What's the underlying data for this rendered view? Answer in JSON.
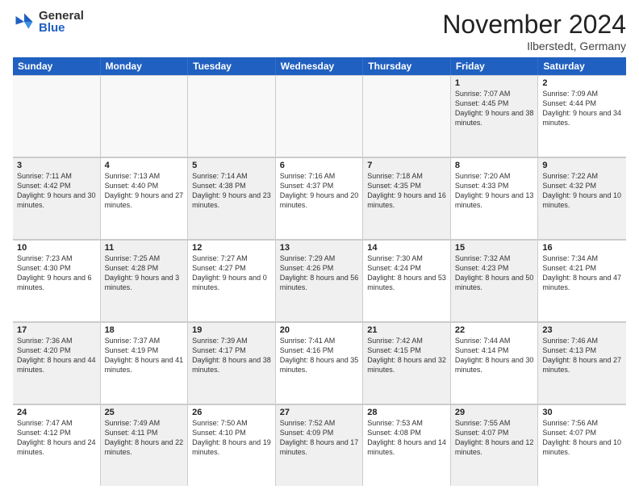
{
  "logo": {
    "general": "General",
    "blue": "Blue"
  },
  "header": {
    "month": "November 2024",
    "location": "Ilberstedt, Germany"
  },
  "weekdays": [
    "Sunday",
    "Monday",
    "Tuesday",
    "Wednesday",
    "Thursday",
    "Friday",
    "Saturday"
  ],
  "weeks": [
    [
      {
        "day": "",
        "info": "",
        "empty": true
      },
      {
        "day": "",
        "info": "",
        "empty": true
      },
      {
        "day": "",
        "info": "",
        "empty": true
      },
      {
        "day": "",
        "info": "",
        "empty": true
      },
      {
        "day": "",
        "info": "",
        "empty": true
      },
      {
        "day": "1",
        "info": "Sunrise: 7:07 AM\nSunset: 4:45 PM\nDaylight: 9 hours\nand 38 minutes.",
        "shaded": true
      },
      {
        "day": "2",
        "info": "Sunrise: 7:09 AM\nSunset: 4:44 PM\nDaylight: 9 hours\nand 34 minutes.",
        "shaded": false
      }
    ],
    [
      {
        "day": "3",
        "info": "Sunrise: 7:11 AM\nSunset: 4:42 PM\nDaylight: 9 hours\nand 30 minutes.",
        "shaded": true
      },
      {
        "day": "4",
        "info": "Sunrise: 7:13 AM\nSunset: 4:40 PM\nDaylight: 9 hours\nand 27 minutes.",
        "shaded": false
      },
      {
        "day": "5",
        "info": "Sunrise: 7:14 AM\nSunset: 4:38 PM\nDaylight: 9 hours\nand 23 minutes.",
        "shaded": true
      },
      {
        "day": "6",
        "info": "Sunrise: 7:16 AM\nSunset: 4:37 PM\nDaylight: 9 hours\nand 20 minutes.",
        "shaded": false
      },
      {
        "day": "7",
        "info": "Sunrise: 7:18 AM\nSunset: 4:35 PM\nDaylight: 9 hours\nand 16 minutes.",
        "shaded": true
      },
      {
        "day": "8",
        "info": "Sunrise: 7:20 AM\nSunset: 4:33 PM\nDaylight: 9 hours\nand 13 minutes.",
        "shaded": false
      },
      {
        "day": "9",
        "info": "Sunrise: 7:22 AM\nSunset: 4:32 PM\nDaylight: 9 hours\nand 10 minutes.",
        "shaded": true
      }
    ],
    [
      {
        "day": "10",
        "info": "Sunrise: 7:23 AM\nSunset: 4:30 PM\nDaylight: 9 hours\nand 6 minutes.",
        "shaded": false
      },
      {
        "day": "11",
        "info": "Sunrise: 7:25 AM\nSunset: 4:28 PM\nDaylight: 9 hours\nand 3 minutes.",
        "shaded": true
      },
      {
        "day": "12",
        "info": "Sunrise: 7:27 AM\nSunset: 4:27 PM\nDaylight: 9 hours\nand 0 minutes.",
        "shaded": false
      },
      {
        "day": "13",
        "info": "Sunrise: 7:29 AM\nSunset: 4:26 PM\nDaylight: 8 hours\nand 56 minutes.",
        "shaded": true
      },
      {
        "day": "14",
        "info": "Sunrise: 7:30 AM\nSunset: 4:24 PM\nDaylight: 8 hours\nand 53 minutes.",
        "shaded": false
      },
      {
        "day": "15",
        "info": "Sunrise: 7:32 AM\nSunset: 4:23 PM\nDaylight: 8 hours\nand 50 minutes.",
        "shaded": true
      },
      {
        "day": "16",
        "info": "Sunrise: 7:34 AM\nSunset: 4:21 PM\nDaylight: 8 hours\nand 47 minutes.",
        "shaded": false
      }
    ],
    [
      {
        "day": "17",
        "info": "Sunrise: 7:36 AM\nSunset: 4:20 PM\nDaylight: 8 hours\nand 44 minutes.",
        "shaded": true
      },
      {
        "day": "18",
        "info": "Sunrise: 7:37 AM\nSunset: 4:19 PM\nDaylight: 8 hours\nand 41 minutes.",
        "shaded": false
      },
      {
        "day": "19",
        "info": "Sunrise: 7:39 AM\nSunset: 4:17 PM\nDaylight: 8 hours\nand 38 minutes.",
        "shaded": true
      },
      {
        "day": "20",
        "info": "Sunrise: 7:41 AM\nSunset: 4:16 PM\nDaylight: 8 hours\nand 35 minutes.",
        "shaded": false
      },
      {
        "day": "21",
        "info": "Sunrise: 7:42 AM\nSunset: 4:15 PM\nDaylight: 8 hours\nand 32 minutes.",
        "shaded": true
      },
      {
        "day": "22",
        "info": "Sunrise: 7:44 AM\nSunset: 4:14 PM\nDaylight: 8 hours\nand 30 minutes.",
        "shaded": false
      },
      {
        "day": "23",
        "info": "Sunrise: 7:46 AM\nSunset: 4:13 PM\nDaylight: 8 hours\nand 27 minutes.",
        "shaded": true
      }
    ],
    [
      {
        "day": "24",
        "info": "Sunrise: 7:47 AM\nSunset: 4:12 PM\nDaylight: 8 hours\nand 24 minutes.",
        "shaded": false
      },
      {
        "day": "25",
        "info": "Sunrise: 7:49 AM\nSunset: 4:11 PM\nDaylight: 8 hours\nand 22 minutes.",
        "shaded": true
      },
      {
        "day": "26",
        "info": "Sunrise: 7:50 AM\nSunset: 4:10 PM\nDaylight: 8 hours\nand 19 minutes.",
        "shaded": false
      },
      {
        "day": "27",
        "info": "Sunrise: 7:52 AM\nSunset: 4:09 PM\nDaylight: 8 hours\nand 17 minutes.",
        "shaded": true
      },
      {
        "day": "28",
        "info": "Sunrise: 7:53 AM\nSunset: 4:08 PM\nDaylight: 8 hours\nand 14 minutes.",
        "shaded": false
      },
      {
        "day": "29",
        "info": "Sunrise: 7:55 AM\nSunset: 4:07 PM\nDaylight: 8 hours\nand 12 minutes.",
        "shaded": true
      },
      {
        "day": "30",
        "info": "Sunrise: 7:56 AM\nSunset: 4:07 PM\nDaylight: 8 hours\nand 10 minutes.",
        "shaded": false
      }
    ]
  ]
}
